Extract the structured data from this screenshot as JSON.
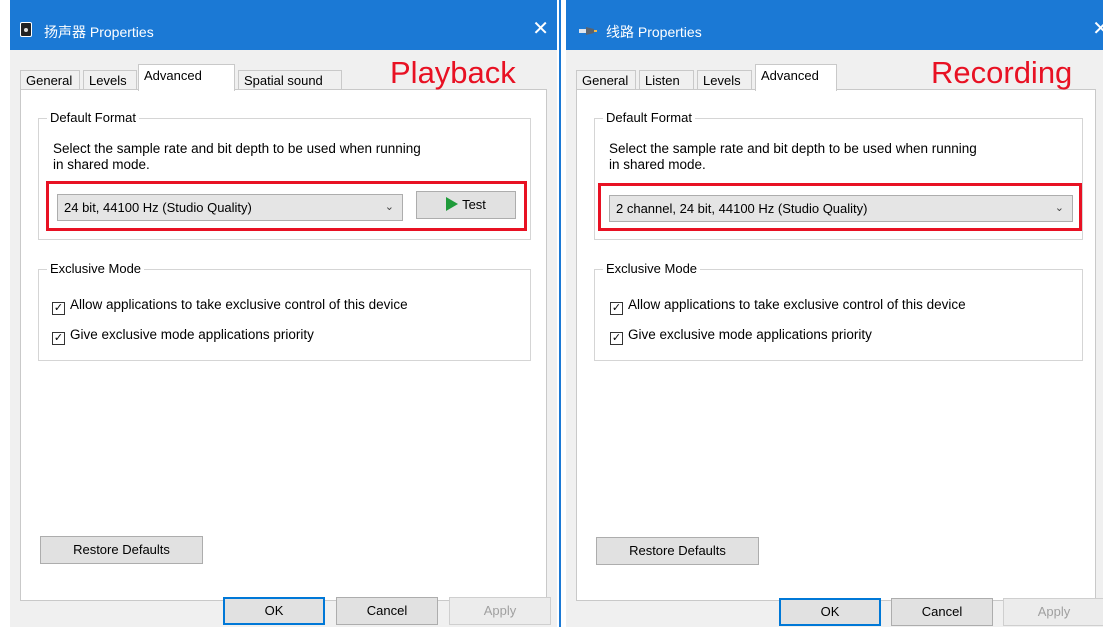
{
  "playback": {
    "title": "扬声器 Properties",
    "close": "✕",
    "annotation": "Playback",
    "tabs": [
      "General",
      "Levels",
      "Advanced",
      "Spatial sound"
    ],
    "default_format": {
      "legend": "Default Format",
      "description_line1": "Select the sample rate and bit depth to be used when running",
      "description_line2": "in shared mode.",
      "selected": "24 bit, 44100 Hz (Studio Quality)",
      "test_label": "Test"
    },
    "exclusive_mode": {
      "legend": "Exclusive Mode",
      "allow_exclusive_label": "Allow applications to take exclusive control of this device",
      "allow_exclusive_checked": true,
      "priority_label": "Give exclusive mode applications priority",
      "priority_checked": true
    },
    "restore_defaults": "Restore Defaults",
    "ok": "OK",
    "cancel": "Cancel",
    "apply": "Apply"
  },
  "recording": {
    "title": "线路 Properties",
    "close": "✕",
    "annotation": "Recording",
    "tabs": [
      "General",
      "Listen",
      "Levels",
      "Advanced"
    ],
    "default_format": {
      "legend": "Default Format",
      "description_line1": "Select the sample rate and bit depth to be used when running",
      "description_line2": "in shared mode.",
      "selected": "2 channel, 24 bit, 44100 Hz (Studio Quality)"
    },
    "exclusive_mode": {
      "legend": "Exclusive Mode",
      "allow_exclusive_label": "Allow applications to take exclusive control of this device",
      "allow_exclusive_checked": true,
      "priority_label": "Give exclusive mode applications priority",
      "priority_checked": true
    },
    "restore_defaults": "Restore Defaults",
    "ok": "OK",
    "cancel": "Cancel",
    "apply": "Apply"
  },
  "colors": {
    "titlebar": "#1b79d5",
    "annotation": "#e81123",
    "highlight_box": "#e81123",
    "play_icon": "#1f9b3a"
  }
}
